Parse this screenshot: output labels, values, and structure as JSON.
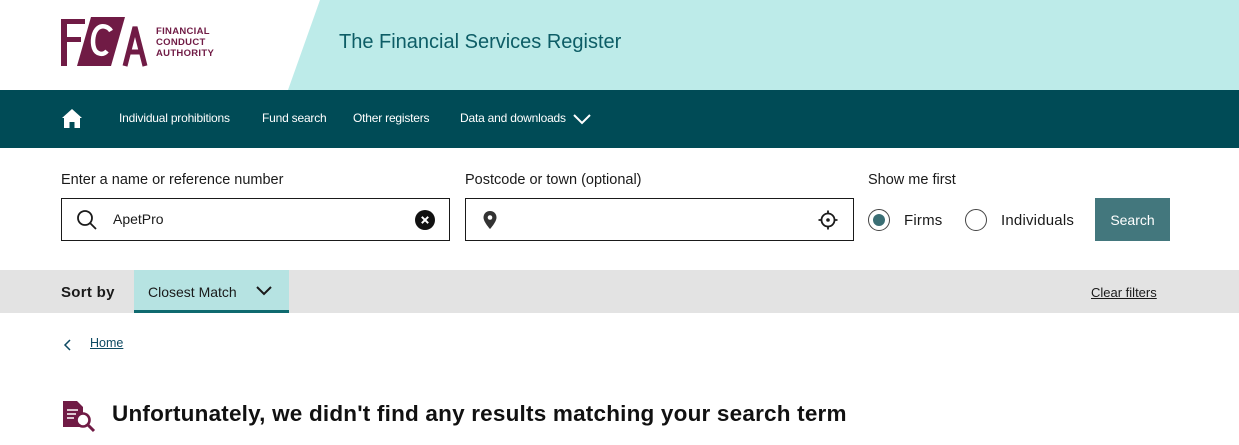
{
  "header": {
    "logo_letters": "FCA",
    "logo_text_lines": [
      "FINANCIAL",
      "CONDUCT",
      "AUTHORITY"
    ],
    "site_title": "The Financial Services Register"
  },
  "nav": {
    "items": [
      {
        "label": "Individual prohibitions"
      },
      {
        "label": "Fund search"
      },
      {
        "label": "Other registers"
      },
      {
        "label": "Data and downloads"
      }
    ]
  },
  "search": {
    "name_label": "Enter a name or reference number",
    "name_value": "ApetPro",
    "postcode_label": "Postcode or town (optional)",
    "postcode_value": "",
    "show_me_first_label": "Show me first",
    "options": [
      {
        "label": "Firms",
        "selected": true
      },
      {
        "label": "Individuals",
        "selected": false
      }
    ],
    "button_label": "Search"
  },
  "sort": {
    "label": "Sort by",
    "value": "Closest Match",
    "clear_filters": "Clear filters"
  },
  "breadcrumb": {
    "home": "Home"
  },
  "result": {
    "message": "Unfortunately, we didn't find any results matching your search term"
  },
  "colors": {
    "brand_maroon": "#701b45",
    "header_teal_light": "#bdebe9",
    "nav_teal_dark": "#004b56",
    "button_teal": "#43777d",
    "sort_select_bg": "#b6e3e2"
  }
}
